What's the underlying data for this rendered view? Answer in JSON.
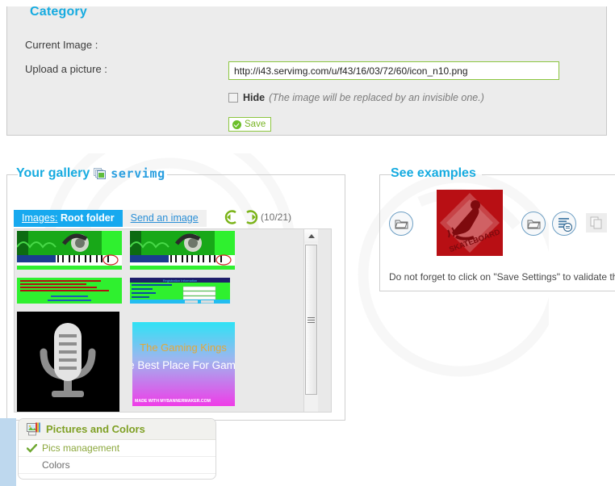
{
  "category_panel": {
    "legend": "Category",
    "labels": {
      "current_image": "Current Image :",
      "upload_picture": "Upload a picture :"
    },
    "upload_input": {
      "value": "http://i43.servimg.com/u/f43/16/03/72/60/icon_n10.png",
      "placeholder": "",
      "border_color": "#8cc63f"
    },
    "hide_checkbox": {
      "label": "Hide",
      "note": "(The image will be replaced by an invisible one.)",
      "checked": false
    },
    "save_button": {
      "label": "Save",
      "icon": "check-circle-icon",
      "accent": "#8cc63f"
    }
  },
  "gallery_panel": {
    "legend": "Your gallery",
    "brand": "servimg",
    "brand_icon": "servimg-stacked-images-icon",
    "tabs": {
      "images_label": "Images:",
      "images_value": "Root folder",
      "send_link": "Send an image"
    },
    "nav": {
      "prev_icon": "arrow-left-circle-icon",
      "next_icon": "arrow-right-circle-icon",
      "pager": "(10/21)"
    },
    "thumbnails": [
      {
        "name": "green-headphones-piano-banner",
        "alt": "Green audio waveform banner with headphones and piano keys"
      },
      {
        "name": "green-headphones-piano-banner-2",
        "alt": "Green audio waveform banner with headphones and piano keys"
      },
      {
        "name": "green-text-block-screenshot",
        "alt": "Bright green page with red text"
      },
      {
        "name": "registration-information-form",
        "alt": "Green registration information form screenshot"
      },
      {
        "name": "microphone-black-icon",
        "alt": "Large grey microphone on black background"
      },
      {
        "name": "gaming-kings-banner",
        "alt": "The Gaming Kings banner"
      }
    ],
    "banner_texts": {
      "gaming_title": "The Gaming Kings",
      "gaming_subtitle": "The Best Place For Gamers",
      "gaming_footer": "MADE WITH MYBANNERMAKER.COM",
      "form_title": "Registration Information",
      "form_save": "Save",
      "form_reset": "Reset"
    },
    "scrollbar": {
      "up_icon": "scroll-up-arrow-icon",
      "grip_icon": "scroll-grip-icon"
    }
  },
  "examples_panel": {
    "legend": "See examples",
    "icons": [
      "folder-icon",
      "folder-icon",
      "topic-document-icon",
      "pages-disabled-icon"
    ],
    "example_image": {
      "name": "skateboard-red-icon",
      "caption": "SKATEBOARD"
    },
    "note": "Do not forget to click on \"Save Settings\" to validate the"
  },
  "menu_popup": {
    "header_icon": "pictures-and-colors-icon",
    "header": "Pictures and Colors",
    "items": [
      {
        "label": "Pics management",
        "selected": true,
        "icon": "check-tick-icon"
      },
      {
        "label": "Colors",
        "selected": false,
        "icon": ""
      }
    ]
  },
  "theme": {
    "accent_cyan": "#16abe0",
    "accent_green": "#8cc63f",
    "tab_blue": "#17a9ef",
    "panel_grey": "#ececec",
    "menu_green": "#7fa024"
  }
}
